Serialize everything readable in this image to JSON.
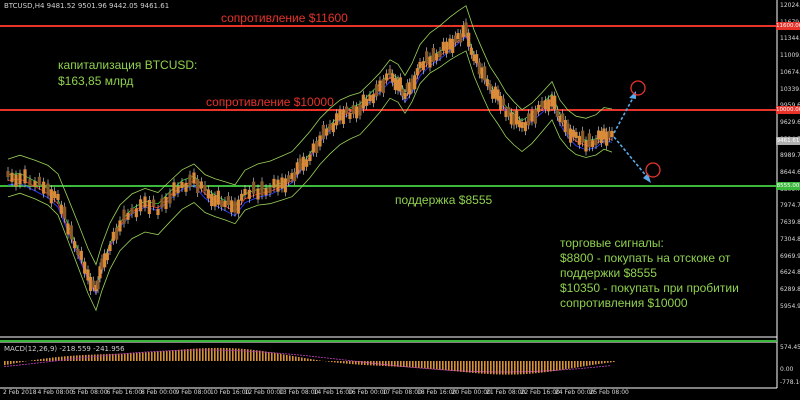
{
  "window": {
    "symbol_line": "BTCUSD,H4  9481.52 9501.96 9442.05 9461.61",
    "macd_line": "MACD(12,26,9) -218.559 -241.956"
  },
  "annotations": {
    "resistance_high": "сопротивление $11600",
    "resistance_low": "сопротивление $10000",
    "support": "поддержка $8555",
    "cap_line1": "капитализация BTCUSD:",
    "cap_line2": "$163,85 млрд",
    "signals": [
      "торговые сигналы:",
      "$8800 - покупать на отскоке от",
      "поддержки $8555",
      "$10350 - покупать при пробитии",
      "сопротивления $10000"
    ]
  },
  "price_scale": {
    "ticks": [
      "12024.60",
      "11679.45",
      "11344.35",
      "11009.60",
      "10674.65",
      "10339.70",
      "9959.60",
      "9629.60",
      "9324.70",
      "8989.75",
      "8644.65",
      "8309.70",
      "7974.75",
      "7639.80",
      "7304.85",
      "6969.90",
      "6624.80",
      "6289.85",
      "5954.90"
    ],
    "badges": [
      {
        "label": "11600.00",
        "color": "#e8332b"
      },
      {
        "label": "10000.00",
        "color": "#e8332b"
      },
      {
        "label": "9461.61",
        "color": "#b0b0b0"
      },
      {
        "label": "8555.00",
        "color": "#3cb83c"
      }
    ]
  },
  "macd_scale": {
    "ticks": [
      "574.455",
      "0.00",
      "-778.162"
    ]
  },
  "time_scale": {
    "labels": [
      "2 Feb 2018",
      "4 Feb 08:00",
      "5 Feb 08:00",
      "6 Feb 16:00",
      "8 Feb 00:00",
      "9 Feb 08:00",
      "10 Feb 16:00",
      "12 Feb 00:00",
      "13 Feb 08:00",
      "14 Feb 16:00",
      "16 Feb 00:00",
      "17 Feb 08:00",
      "18 Feb 16:00",
      "20 Feb 00:00",
      "21 Feb 08:00",
      "22 Feb 16:00",
      "24 Feb 00:00",
      "25 Feb 08:00"
    ]
  },
  "colors": {
    "resistance": "#e8332b",
    "support": "#3cb83c",
    "bull_candle": "#d98b3a",
    "bear_candle": "#d98b3a",
    "forecast": "#5aa9e6"
  }
}
